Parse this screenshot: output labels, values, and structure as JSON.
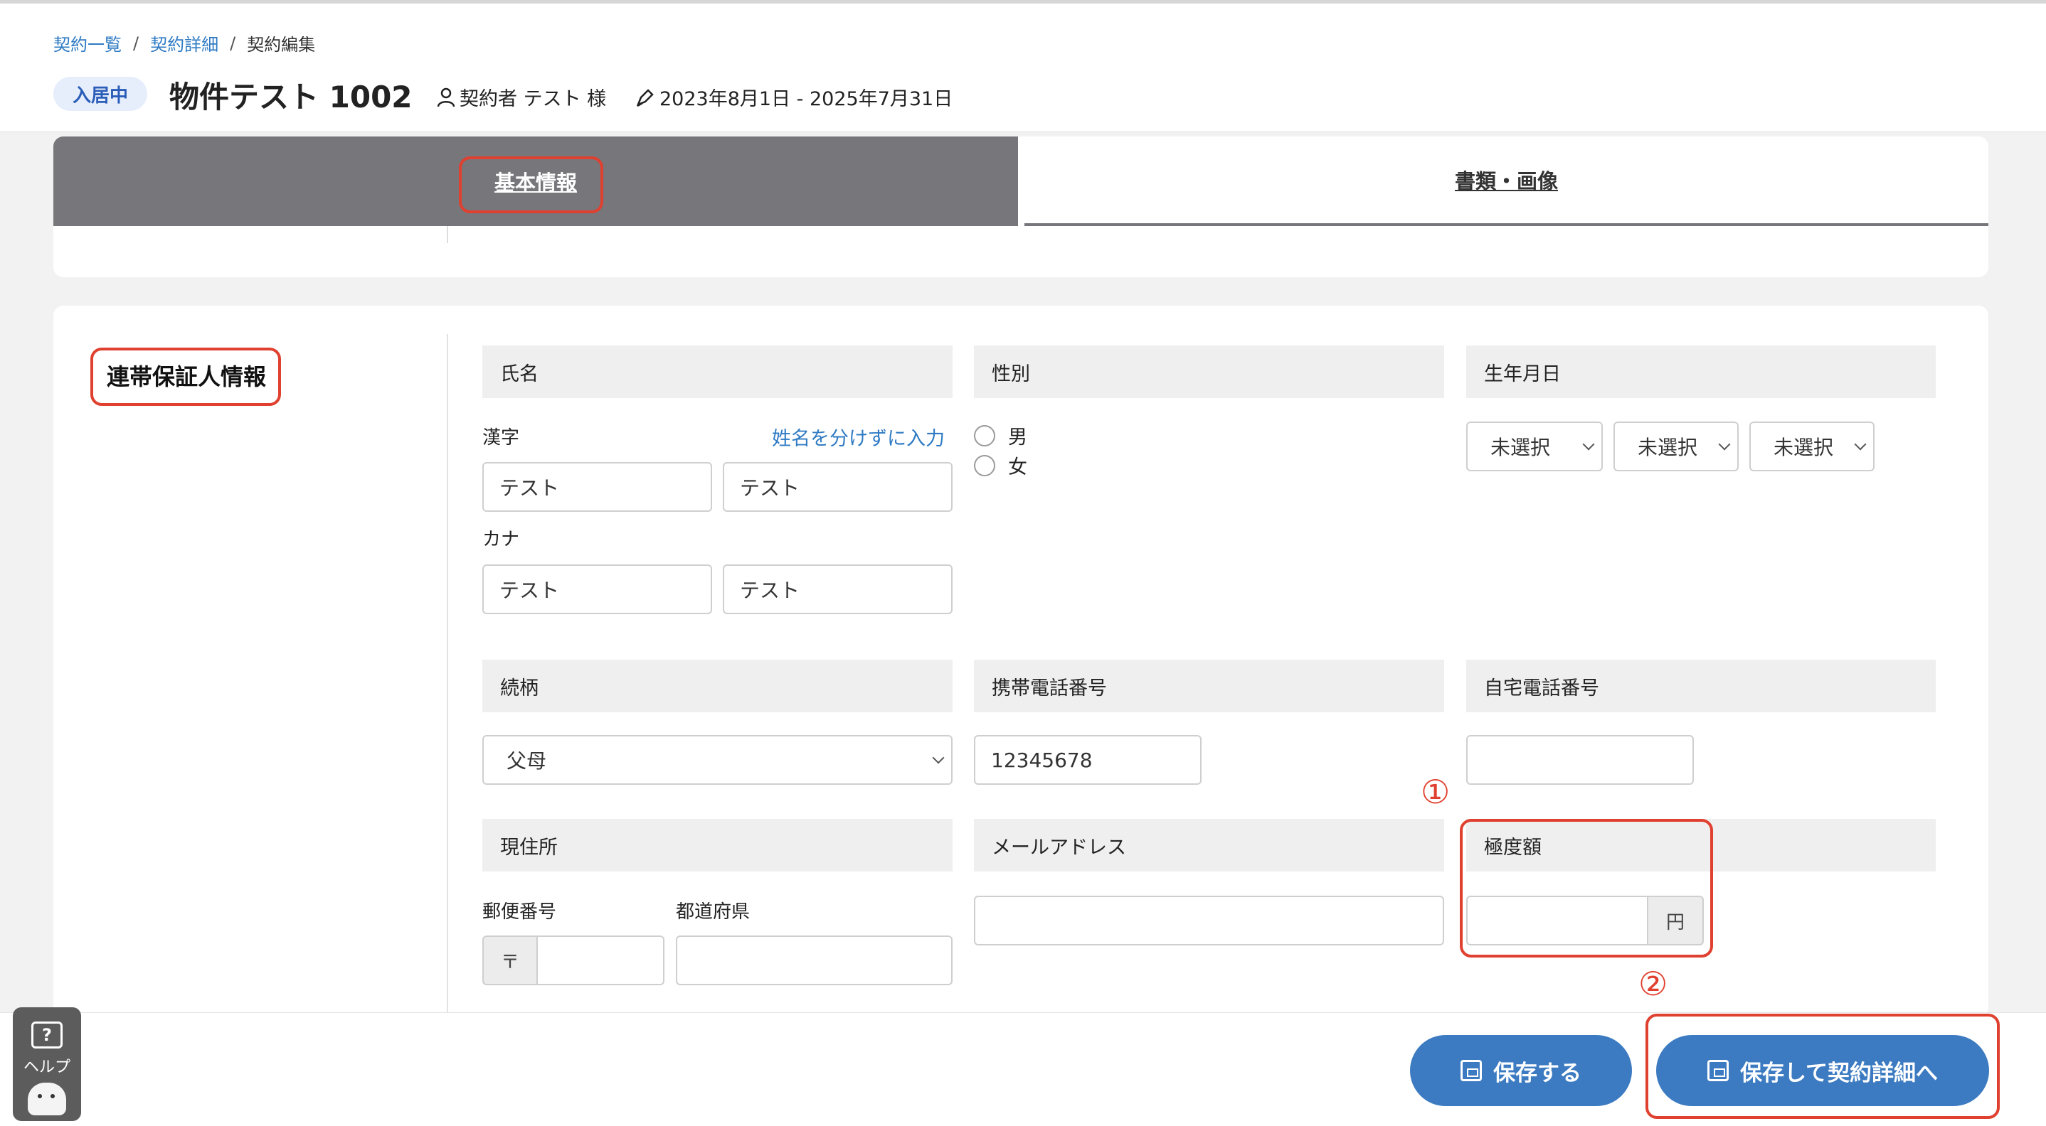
{
  "breadcrumb": {
    "items": [
      "契約一覧",
      "契約詳細",
      "契約編集"
    ],
    "separator": "/"
  },
  "header": {
    "status": "入居中",
    "title": "物件テスト 1002",
    "contractor": "契約者 テスト 様",
    "period": "2023年8月1日 - 2025年7月31日"
  },
  "tabs": {
    "basic": "基本情報",
    "documents": "書類・画像"
  },
  "section": {
    "title": "連帯保証人情報"
  },
  "fields": {
    "name": {
      "header": "氏名",
      "kanji_label": "漢字",
      "split_link": "姓名を分けずに入力",
      "kanji_last": "テスト",
      "kanji_first": "テスト",
      "kana_label": "カナ",
      "kana_last": "テスト",
      "kana_first": "テスト"
    },
    "gender": {
      "header": "性別",
      "options": [
        "男",
        "女"
      ]
    },
    "birthdate": {
      "header": "生年月日",
      "year": "未選択",
      "month": "未選択",
      "day": "未選択"
    },
    "relationship": {
      "header": "続柄",
      "value": "父母"
    },
    "mobile": {
      "header": "携帯電話番号",
      "value": "12345678"
    },
    "home_phone": {
      "header": "自宅電話番号",
      "value": ""
    },
    "address": {
      "header": "現住所",
      "postal_label": "郵便番号",
      "postal_prefix": "〒",
      "postal_value": "",
      "prefecture_label": "都道府県",
      "prefecture_value": ""
    },
    "email": {
      "header": "メールアドレス",
      "value": ""
    },
    "limit": {
      "header": "極度額",
      "value": "",
      "unit": "円"
    }
  },
  "markers": {
    "one": "①",
    "two": "②"
  },
  "footer": {
    "save": "保存する",
    "save_and_go": "保存して契約詳細へ"
  },
  "help": {
    "icon": "?",
    "label": "ヘルプ"
  },
  "colors": {
    "accent": "#3c7bc1",
    "annotation": "#e0402f",
    "tab_active": "#77767b",
    "link": "#2f7bc4"
  }
}
